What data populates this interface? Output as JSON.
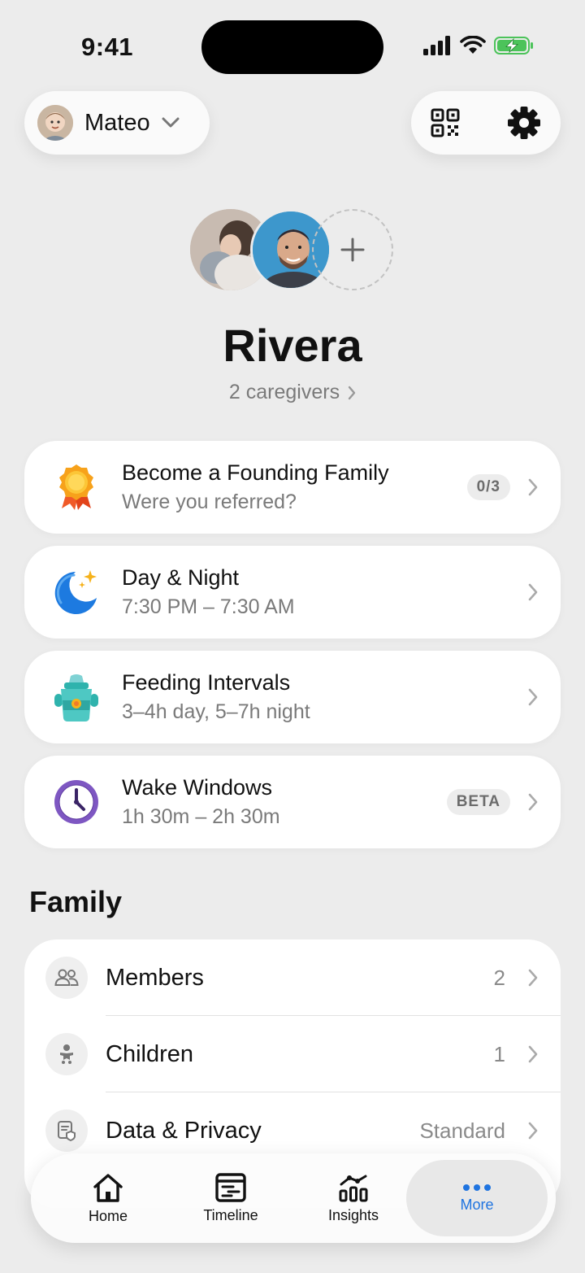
{
  "status_bar": {
    "time": "9:41"
  },
  "header": {
    "child_name": "Mateo"
  },
  "family": {
    "name": "Rivera",
    "caregivers_label": "2 caregivers"
  },
  "cards": [
    {
      "title": "Become a Founding Family",
      "subtitle": "Were you referred?",
      "badge": "0/3",
      "icon": "medal-icon"
    },
    {
      "title": "Day & Night",
      "subtitle": "7:30 PM – 7:30 AM",
      "badge": "",
      "icon": "moon-icon"
    },
    {
      "title": "Feeding Intervals",
      "subtitle": "3–4h day, 5–7h night",
      "badge": "",
      "icon": "sippy-cup-icon"
    },
    {
      "title": "Wake Windows",
      "subtitle": "1h 30m – 2h 30m",
      "badge": "BETA",
      "icon": "clock-icon"
    }
  ],
  "family_section": {
    "title": "Family",
    "rows": [
      {
        "label": "Members",
        "value": "2",
        "icon": "people-icon"
      },
      {
        "label": "Children",
        "value": "1",
        "icon": "baby-icon"
      },
      {
        "label": "Data & Privacy",
        "value": "Standard",
        "icon": "privacy-icon"
      }
    ]
  },
  "nav": {
    "items": [
      {
        "label": "Home",
        "icon": "home-icon"
      },
      {
        "label": "Timeline",
        "icon": "timeline-icon"
      },
      {
        "label": "Insights",
        "icon": "insights-icon"
      },
      {
        "label": "More",
        "icon": "more-icon"
      }
    ],
    "active": "More",
    "active_color": "#1f74e0"
  }
}
